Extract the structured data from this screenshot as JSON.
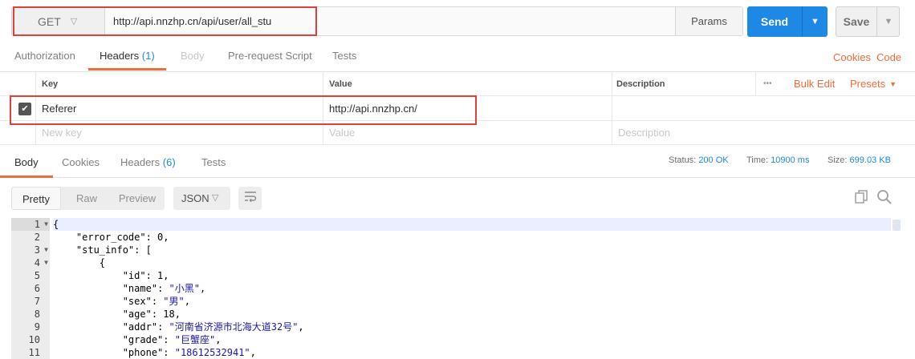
{
  "request": {
    "method": "GET",
    "url": "http://api.nnzhp.cn/api/user/all_stu",
    "params_label": "Params",
    "send_label": "Send",
    "save_label": "Save"
  },
  "request_tabs": [
    {
      "label": "Authorization",
      "count": ""
    },
    {
      "label": "Headers",
      "count": "(1)"
    },
    {
      "label": "Body",
      "count": ""
    },
    {
      "label": "Pre-request Script",
      "count": ""
    },
    {
      "label": "Tests",
      "count": ""
    }
  ],
  "links": {
    "cookies": "Cookies",
    "code": "Code"
  },
  "headers_table": {
    "columns": {
      "key": "Key",
      "value": "Value",
      "description": "Description"
    },
    "more": "•••",
    "bulk_edit": "Bulk Edit",
    "presets": "Presets",
    "rows": [
      {
        "checked": true,
        "key": "Referer",
        "value": "http://api.nnzhp.cn/",
        "description": ""
      }
    ],
    "new_row": {
      "key": "New key",
      "value": "Value",
      "description": "Description"
    }
  },
  "response_tabs": [
    {
      "label": "Body",
      "count": ""
    },
    {
      "label": "Cookies",
      "count": ""
    },
    {
      "label": "Headers",
      "count": "(6)"
    },
    {
      "label": "Tests",
      "count": ""
    }
  ],
  "status": {
    "status_label": "Status:",
    "status_value": "200 OK",
    "time_label": "Time:",
    "time_value": "10900 ms",
    "size_label": "Size:",
    "size_value": "699.03 KB"
  },
  "view": {
    "modes": [
      "Pretty",
      "Raw",
      "Preview"
    ],
    "selected": "Pretty",
    "format": "JSON"
  },
  "code_lines": [
    "{",
    "    \"error_code\": 0,",
    "    \"stu_info\": [",
    "        {",
    "            \"id\": 1,",
    "            \"name\": \"小黑\",",
    "            \"sex\": \"男\",",
    "            \"age\": 18,",
    "            \"addr\": \"河南省济源市北海大道32号\",",
    "            \"grade\": \"巨蟹座\",",
    "            \"phone\": \"18612532941\","
  ],
  "line_numbers": [
    "1",
    "2",
    "3",
    "4",
    "5",
    "6",
    "7",
    "8",
    "9",
    "10",
    "11"
  ],
  "colors": {
    "accent": "#f26b3a",
    "send": "#1e88e5",
    "highlight_box": "#e0413c"
  }
}
